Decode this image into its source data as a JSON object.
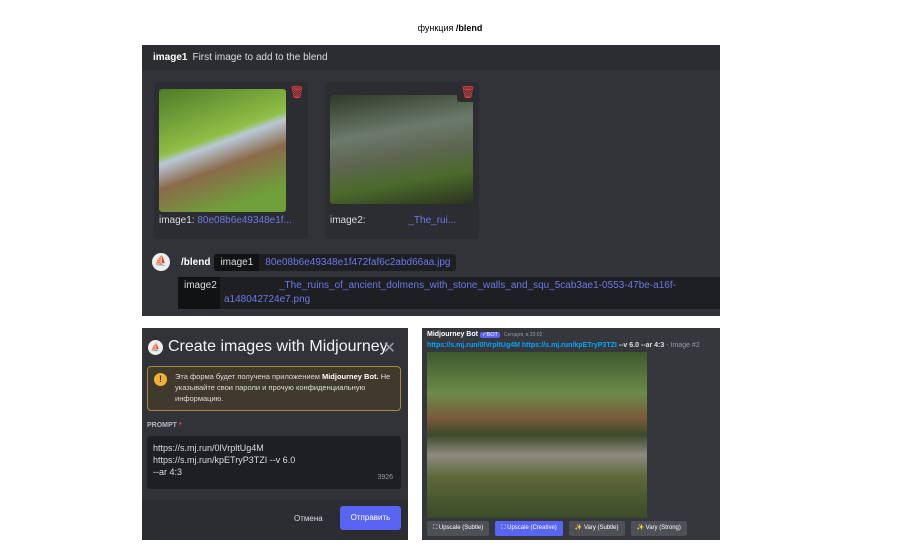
{
  "title": {
    "prefix": "функция",
    "command": "/blend"
  },
  "blend_panel": {
    "header_option": "image1",
    "header_desc": "First image to add to the blend",
    "cards": [
      {
        "label": "image1:",
        "value": "80e08b6e49348e1f..."
      },
      {
        "label": "image2:",
        "value": "_The_rui..."
      }
    ],
    "command": "/blend",
    "options": [
      {
        "key": "image1",
        "value": "80e08b6e49348e1f472faf6c2abd66aa.jpg"
      },
      {
        "key": "image2",
        "value": "_The_ruins_of_ancient_dolmens_with_stone_walls_and_squ_5cab3ae1-0553-47be-a16f-a148042724e7.png"
      }
    ]
  },
  "modal": {
    "title": "Create images with Midjourney",
    "warning_pre": "Эта форма будет получена приложением ",
    "warning_bold": "Midjourney Bot.",
    "warning_post": " Не указывайте свои пароли и прочую конфиденциальную информацию.",
    "prompt_label": "PROMPT",
    "required_mark": "*",
    "prompt_lines": [
      "https://s.mj.run/0lVrpltUg4M",
      "https://s.mj.run/kpETryP3TZI --v 6.0",
      "--ar 4:3"
    ],
    "char_count": "3926",
    "cancel": "Отмена",
    "submit": "Отправить"
  },
  "result": {
    "author": "Midjourney Bot",
    "badge": "✓BOT",
    "time": "Сегодня, в 20:02",
    "link1": "https://s.mj.run/0lVrpltUg4M",
    "link2": "https://s.mj.run/kpETryP3TZI",
    "params": "--v 6.0 --ar 4:3",
    "suffix": "- Image #2",
    "buttons": [
      "Upscale (Subtle)",
      "Upscale (Creative)",
      "Vary (Subtle)",
      "Vary (Strong)"
    ]
  },
  "colors": {
    "accent": "#5865f2",
    "link": "#6d78e8",
    "danger": "#f23f43"
  }
}
